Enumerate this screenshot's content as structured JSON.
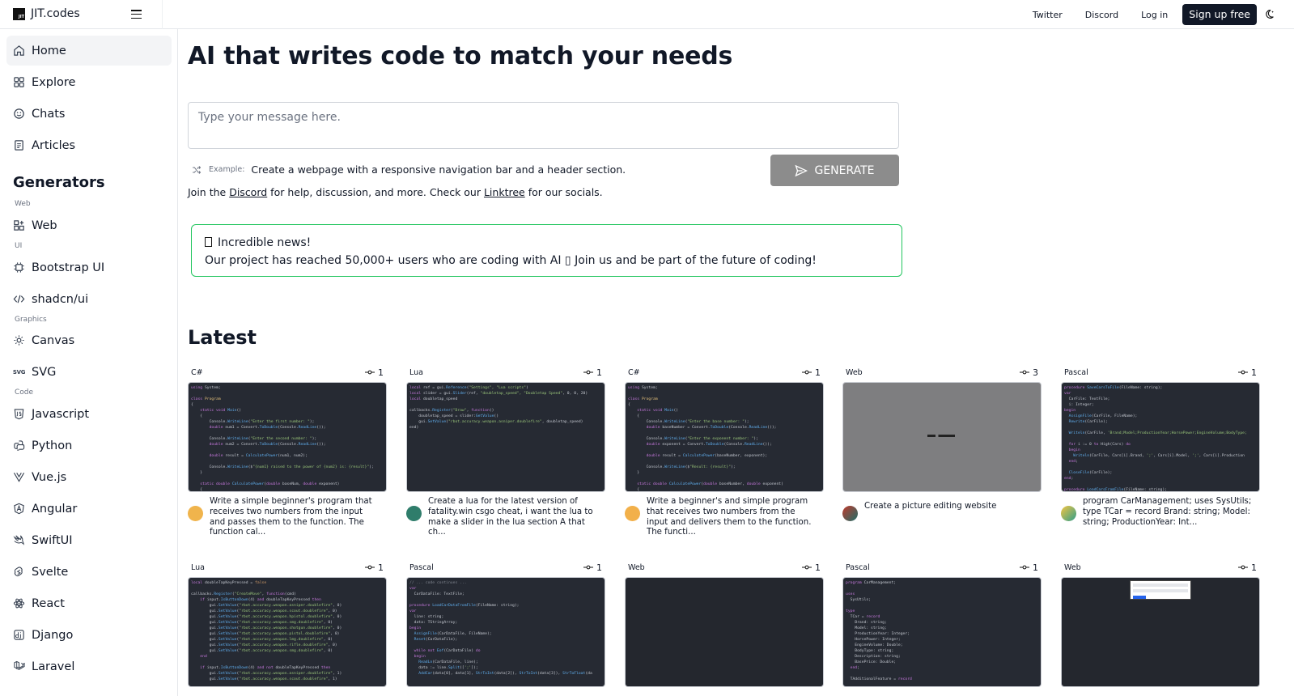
{
  "brand": {
    "name": "JIT.codes",
    "logo_text": "JIT"
  },
  "top_nav": {
    "twitter": "Twitter",
    "discord": "Discord",
    "login": "Log in",
    "signup": "Sign up free"
  },
  "sidebar": {
    "main_items": [
      {
        "label": "Home",
        "icon": "home-icon"
      },
      {
        "label": "Explore",
        "icon": "grid-icon"
      },
      {
        "label": "Chats",
        "icon": "smile-icon"
      },
      {
        "label": "Articles",
        "icon": "document-icon"
      }
    ],
    "section_title": "Generators",
    "groups": {
      "web": "Web",
      "ui": "UI",
      "graphics": "Graphics",
      "code": "Code"
    },
    "web_items": [
      {
        "label": "Web"
      }
    ],
    "ui_items": [
      {
        "label": "Bootstrap UI"
      },
      {
        "label": "shadcn/ui"
      }
    ],
    "graphics_items": [
      {
        "label": "Canvas"
      },
      {
        "label": "SVG",
        "icon_text": "SVG"
      }
    ],
    "code_items": [
      {
        "label": "Javascript"
      },
      {
        "label": "Python"
      },
      {
        "label": "Vue.js"
      },
      {
        "label": "Angular"
      },
      {
        "label": "SwiftUI"
      },
      {
        "label": "Svelte"
      },
      {
        "label": "React"
      },
      {
        "label": "Django"
      },
      {
        "label": "Laravel"
      }
    ]
  },
  "hero": {
    "title": "AI that writes code to match your needs",
    "input_placeholder": "Type your message here.",
    "example_label": "Example:",
    "example_text": "Create a webpage with a responsive navigation bar and a header section.",
    "generate_label": "GENERATE",
    "join_prefix": "Join the ",
    "join_discord": "Discord",
    "join_middle": " for help, discussion, and more. Check our ",
    "join_linktree": "Linktree",
    "join_suffix": " for our socials."
  },
  "news": {
    "headline": "Incredible news!",
    "body": "Our project has reached 50,000+ users who are coding with AI ▯ Join us and be part of the future of coding!"
  },
  "latest": {
    "title": "Latest",
    "cards": [
      {
        "lang": "C#",
        "forks": "1",
        "desc": "Write a simple beginner's program that receives two numbers from the input and passes them to the function. The function cal...",
        "avatar_color": "#f0b44c"
      },
      {
        "lang": "Lua",
        "forks": "1",
        "desc": "Create a lua for the latest version of fatality.win csgo cheat, i want the lua to make a slider in the lua section A that ch...",
        "avatar_color": "#2f7d6b"
      },
      {
        "lang": "C#",
        "forks": "1",
        "desc": "Write a beginner's and simple program that receives two numbers from the input and delivers them to the function. The functi...",
        "avatar_color": "#f2b04a"
      },
      {
        "lang": "Web",
        "forks": "3",
        "desc": "Create a picture editing website",
        "avatar_color": "#c0392b"
      },
      {
        "lang": "Pascal",
        "forks": "1",
        "desc": "program CarManagement; uses SysUtils; type TCar = record Brand: string; Model: string; ProductionYear: Int...",
        "avatar_color": "#4caf7a"
      },
      {
        "lang": "Lua",
        "forks": "1"
      },
      {
        "lang": "Pascal",
        "forks": "1"
      },
      {
        "lang": "Web",
        "forks": "1"
      },
      {
        "lang": "Pascal",
        "forks": "1"
      },
      {
        "lang": "Web",
        "forks": "1"
      }
    ]
  }
}
